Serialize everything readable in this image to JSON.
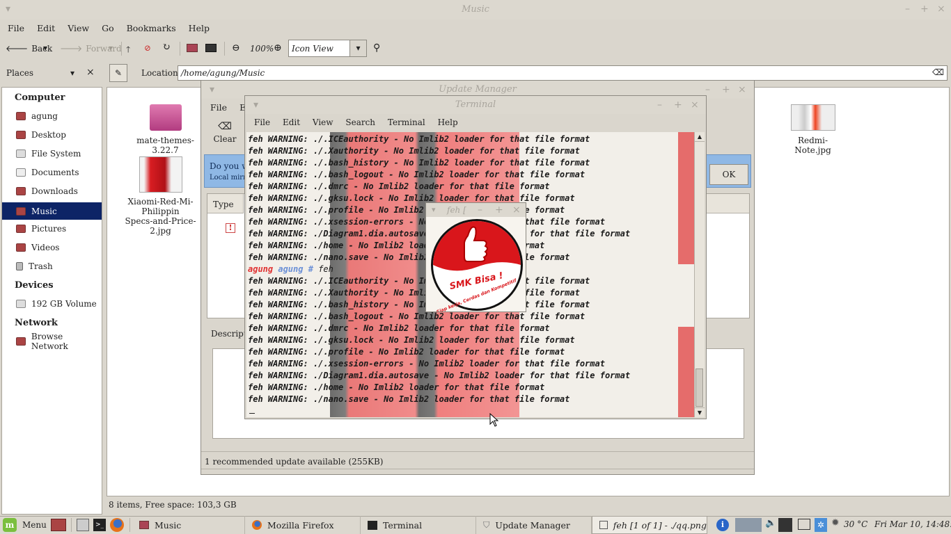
{
  "fm": {
    "title": "Music",
    "menu": [
      "File",
      "Edit",
      "View",
      "Go",
      "Bookmarks",
      "Help"
    ],
    "toolbar": {
      "back": "Back",
      "forward": "Forward",
      "zoom": "100%",
      "view_mode": "Icon View"
    },
    "places_label": "Places",
    "location_label": "Location:",
    "location_value": "/home/agung/Music",
    "sidebar": {
      "computer": "Computer",
      "items": [
        "agung",
        "Desktop",
        "File System",
        "Documents",
        "Downloads",
        "Music",
        "Pictures",
        "Videos",
        "Trash"
      ],
      "devices": "Devices",
      "device_items": [
        "192 GB Volume"
      ],
      "network": "Network",
      "network_items": [
        "Browse Network"
      ]
    },
    "files": [
      {
        "name": "mate-themes-3.22.7"
      },
      {
        "name_l1": "Xiaomi-Red-Mi-Philippin",
        "name_l2": "Specs-and-Price-2.jpg"
      },
      {
        "name": "Redmi-Note.jpg"
      }
    ],
    "status": "8 items, Free space: 103,3 GB"
  },
  "um": {
    "title": "Update Manager",
    "menu": [
      "File",
      "Edi"
    ],
    "clear": "Clear",
    "info": "Do you w",
    "info_sub": "Local mirror",
    "ok": "OK",
    "col_type": "Type",
    "desc": "Descriptio",
    "status": "1 recommended update available (255KB)"
  },
  "term": {
    "title": "Terminal",
    "menu": [
      "File",
      "Edit",
      "View",
      "Search",
      "Terminal",
      "Help"
    ],
    "lines1": [
      "feh WARNING: ./.ICEauthority - No Imlib2 loader for that file format",
      "feh WARNING: ./.Xauthority - No Imlib2 loader for that file format",
      "feh WARNING: ./.bash_history - No Imlib2 loader for that file format",
      "feh WARNING: ./.bash_logout - No Imlib2 loader for that file format",
      "feh WARNING: ./.dmrc - No Imlib2 loader for that file format",
      "feh WARNING: ./.gksu.lock - No Imlib2 loader for that file format",
      "feh WARNING: ./.profile - No Imlib2 loader for that file format",
      "feh WARNING: ./.xsession-errors - No Imlib2 loader for that file format",
      "feh WARNING: ./Diagram1.dia.autosave - No Imlib2 loader for that file format",
      "feh WARNING: ./home - No Imlib2 loader for that file format",
      "feh WARNING: ./nano.save - No Imlib2 loader for that file format"
    ],
    "prompt_user": "agung",
    "prompt_dir": "agung",
    "prompt_sym": "#",
    "prompt_cmd": "feh",
    "lines2": [
      "feh WARNING: ./.ICEauthority - No Imlib2 loader for that file format",
      "feh WARNING: ./.Xauthority - No Imlib2 loader for that file format",
      "feh WARNING: ./.bash_history - No Imlib2 loader for that file format",
      "feh WARNING: ./.bash_logout - No Imlib2 loader for that file format",
      "feh WARNING: ./.dmrc - No Imlib2 loader for that file format",
      "feh WARNING: ./.gksu.lock - No Imlib2 loader for that file format",
      "feh WARNING: ./.profile - No Imlib2 loader for that file format",
      "feh WARNING: ./.xsession-errors - No Imlib2 loader for that file format",
      "feh WARNING: ./Diagram1.dia.autosave - No Imlib2 loader for that file format",
      "feh WARNING: ./home - No Imlib2 loader for that file format",
      "feh WARNING: ./nano.save - No Imlib2 loader for that file format"
    ]
  },
  "feh": {
    "title": "feh [",
    "logo_text": "SMK Bisa !",
    "logo_sub": "Siap kerja, Cerdas dan Kompetitif"
  },
  "taskbar": {
    "menu": "Menu",
    "tasks": [
      "Music",
      "Mozilla Firefox",
      "Terminal",
      "Update Manager",
      "feh [1 of 1] - ./qq.png"
    ],
    "temp": "30 °C",
    "clock": "Fri Mar 10, 14:48:11"
  },
  "colors": {
    "selection": "#0d2466",
    "accent_red": "#d9161b",
    "prompt_red": "#e03030",
    "prompt_blue": "#6a8fd6"
  }
}
